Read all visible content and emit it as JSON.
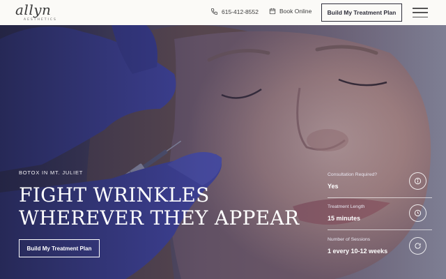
{
  "header": {
    "logo_text": "allyn",
    "logo_subtext": "AESTHETICS",
    "phone": "615-412-8552",
    "book_label": "Book Online",
    "cta_label": "Build My Treatment Plan"
  },
  "hero": {
    "eyebrow": "BOTOX IN MT. JULIET",
    "headline_line1": "FIGHT WRINKLES",
    "headline_line2": "WHEREVER THEY APPEAR",
    "cta_label": "Build My Treatment Plan",
    "info": [
      {
        "label": "Consultation Required?",
        "value": "Yes",
        "icon": "info-icon"
      },
      {
        "label": "Treatment Length",
        "value": "15 minutes",
        "icon": "clock-icon"
      },
      {
        "label": "Number of Sessions",
        "value": "1 every 10-12 weeks",
        "icon": "repeat-icon"
      }
    ]
  },
  "colors": {
    "header_bg": "#fbfaf7",
    "overlay": "#2a2c5a",
    "glove": "#4b4fc4",
    "text_light": "#ffffff"
  }
}
